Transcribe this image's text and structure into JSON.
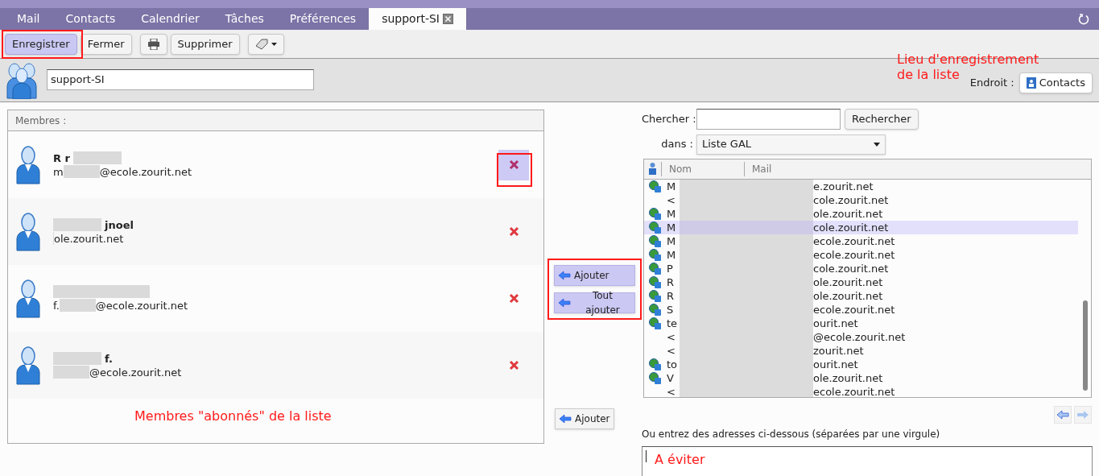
{
  "tabs": [
    {
      "label": "Mail",
      "selected": false,
      "closable": false
    },
    {
      "label": "Contacts",
      "selected": false,
      "closable": false
    },
    {
      "label": "Calendrier",
      "selected": false,
      "closable": false
    },
    {
      "label": "Tâches",
      "selected": false,
      "closable": false
    },
    {
      "label": "Préférences",
      "selected": false,
      "closable": false
    },
    {
      "label": "support-SI",
      "selected": true,
      "closable": true
    }
  ],
  "toolbar": [
    {
      "kind": "text",
      "label": "Enregistrer",
      "selected": true
    },
    {
      "kind": "text",
      "label": "Fermer",
      "selected": false
    },
    {
      "kind": "print",
      "selected": false
    },
    {
      "kind": "text",
      "label": "Supprimer",
      "selected": false
    },
    {
      "kind": "tag",
      "selected": false
    }
  ],
  "list_name": {
    "value": "support-SI"
  },
  "location": {
    "label": "Endroit :",
    "button": "Contacts"
  },
  "members": {
    "title": "Membres :",
    "items": [
      {
        "name": "R r",
        "email_start": "m",
        "email_end": "@ecole.zourit.net",
        "hovered": true
      },
      {
        "name": "jnoel",
        "email_end": "ole.zourit.net",
        "hovered": false
      },
      {
        "email_start": "f.",
        "email_end": "@ecole.zourit.net",
        "hovered": false
      },
      {
        "name": "f.",
        "email_end": "@ecole.zourit.net",
        "hovered": false
      }
    ]
  },
  "transfer": {
    "add": "Ajouter",
    "add_all": "Tout ajouter",
    "add_typed": "Ajouter"
  },
  "search": {
    "label": "Chercher :",
    "button": "Rechercher",
    "in_label": "dans :",
    "source": "Liste GAL"
  },
  "results": {
    "columns": [
      "Nom",
      "Mail"
    ],
    "rows": [
      {
        "nom": "M",
        "mail": "e.zourit.net",
        "icon": true,
        "selected": false
      },
      {
        "nom": "<",
        "mail": "cole.zourit.net",
        "icon": false,
        "selected": false
      },
      {
        "nom": "M",
        "mail": "ole.zourit.net",
        "icon": true,
        "selected": false
      },
      {
        "nom": "M",
        "mail": "cole.zourit.net",
        "icon": true,
        "selected": true
      },
      {
        "nom": "M",
        "mail": "ecole.zourit.net",
        "icon": true,
        "selected": false
      },
      {
        "nom": "M",
        "mail": "ecole.zourit.net",
        "icon": true,
        "selected": false
      },
      {
        "nom": "P",
        "mail": "cole.zourit.net",
        "icon": true,
        "selected": false
      },
      {
        "nom": "R",
        "mail": "ole.zourit.net",
        "icon": true,
        "selected": false
      },
      {
        "nom": "R",
        "mail": "ole.zourit.net",
        "icon": true,
        "selected": false
      },
      {
        "nom": "S",
        "mail": "ecole.zourit.net",
        "icon": true,
        "selected": false
      },
      {
        "nom": "te",
        "mail": "ourit.net",
        "icon": true,
        "selected": false
      },
      {
        "nom": "<",
        "mail": "@ecole.zourit.net",
        "icon": false,
        "selected": false
      },
      {
        "nom": "<",
        "mail": "zourit.net",
        "icon": false,
        "selected": false
      },
      {
        "nom": "to",
        "mail": "ourit.net",
        "icon": true,
        "selected": false
      },
      {
        "nom": "V",
        "mail": "ole.zourit.net",
        "icon": true,
        "selected": false
      },
      {
        "nom": "<",
        "mail": "ecole.zourit.net",
        "icon": false,
        "selected": false
      }
    ]
  },
  "addresses": {
    "label": "Ou entrez des adresses ci-dessous (séparées par une virgule)"
  },
  "annotations": {
    "location": "Lieu d'enregistrement de la liste",
    "members": "Membres \"abonnés\" de la liste",
    "avoid": "A éviter"
  }
}
